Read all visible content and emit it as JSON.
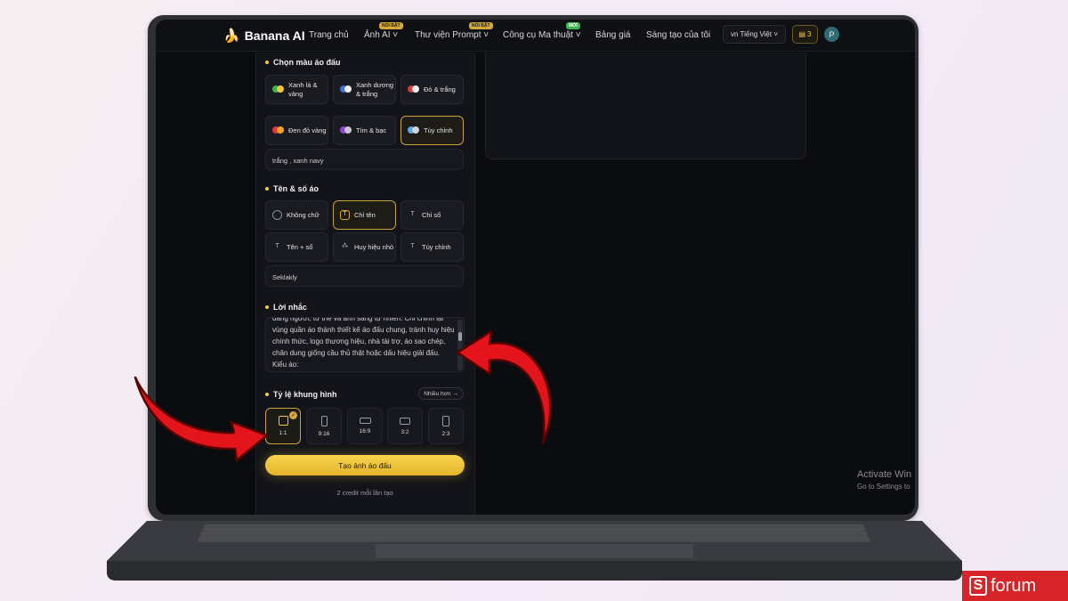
{
  "nav": {
    "logo": "Banana AI",
    "items": [
      {
        "label": "Trang chủ"
      },
      {
        "label": "Ảnh AI ˅",
        "badge": "NỔI BẬT"
      },
      {
        "label": "Thư viện Prompt ˅",
        "badge": "NỔI BẬT"
      },
      {
        "label": "Công cụ Ma thuật ˅",
        "badge": "MỚI"
      },
      {
        "label": "Bảng giá"
      },
      {
        "label": "Sáng tạo của tôi"
      }
    ],
    "language": "vn Tiếng Việt ˅",
    "credits": "3",
    "avatar": "P"
  },
  "color_section": {
    "title": "Chọn màu áo đấu",
    "options": [
      {
        "label": "Xanh lá & vàng",
        "colors": [
          "#3cb44b",
          "#f5c842"
        ]
      },
      {
        "label": "Xanh dương & trắng",
        "colors": [
          "#3d6fe0",
          "#f2f2f2"
        ]
      },
      {
        "label": "Đỏ & trắng",
        "colors": [
          "#e0353b",
          "#f2f2f2"
        ]
      },
      {
        "label": "Đen đỏ vàng",
        "colors": [
          "#e0353b",
          "#f5a623"
        ]
      },
      {
        "label": "Tím & bạc",
        "colors": [
          "#8b44d8",
          "#c8c8d0"
        ]
      },
      {
        "label": "Tùy chỉnh",
        "colors": [
          "#5aa7e6",
          "#cfd5dc"
        ]
      }
    ],
    "custom_value": "trắng , xanh navy"
  },
  "name_section": {
    "title": "Tên & số áo",
    "options": [
      {
        "label": "Không chữ"
      },
      {
        "label": "Chỉ tên"
      },
      {
        "label": "Chỉ số"
      },
      {
        "label": "Tên + số"
      },
      {
        "label": "Huy hiệu nhỏ"
      },
      {
        "label": "Tùy chỉnh"
      }
    ],
    "custom_value": "Seklakly"
  },
  "prompt_section": {
    "title": "Lời nhắc",
    "text": "dáng người, tư thế và ánh sáng tự nhiên. Chỉ chỉnh lại vùng quần áo thành thiết kế áo đấu chung, tránh huy hiệu chính thức, logo thương hiệu, nhà tài trợ, áo sao chép, chân dung giống cầu thủ thật hoặc dấu hiệu giải đấu. Kiểu áo:"
  },
  "ratio_section": {
    "title": "Tỷ lệ khung hình",
    "more_label": "Nhiều hơn →",
    "options": [
      {
        "label": "1:1"
      },
      {
        "label": "9:16"
      },
      {
        "label": "16:9"
      },
      {
        "label": "3:2"
      },
      {
        "label": "2:3"
      }
    ]
  },
  "create_button": "Tạo ảnh áo đấu",
  "credit_note": "2 credit mỗi lần tạo",
  "windows_watermark": {
    "title": "Activate Win",
    "subtitle": "Go to Settings to"
  },
  "brand": "forum",
  "colors": {
    "accent": "#f5c842",
    "selected_border": "#c9a33a",
    "arrow": "#e3141b"
  }
}
